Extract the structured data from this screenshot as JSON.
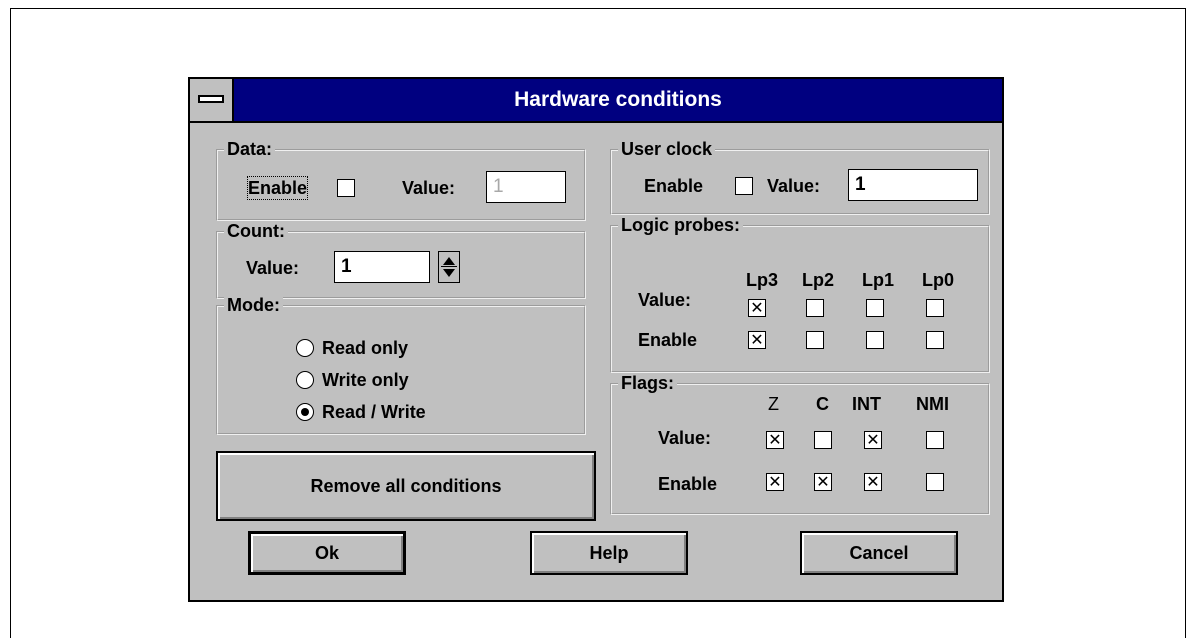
{
  "dialog": {
    "title": "Hardware conditions",
    "data_group": {
      "label": "Data:",
      "enable_label": "Enable",
      "enable_checked": false,
      "value_label": "Value:",
      "value": "1"
    },
    "count_group": {
      "label": "Count:",
      "value_label": "Value:",
      "value": "1"
    },
    "mode_group": {
      "label": "Mode:",
      "options": [
        "Read only",
        "Write only",
        "Read / Write"
      ],
      "selected": "Read / Write"
    },
    "remove_button": "Remove all conditions",
    "user_clock": {
      "label": "User clock",
      "enable_label": "Enable",
      "enable_checked": false,
      "value_label": "Value:",
      "value": "1"
    },
    "logic_probes": {
      "label": "Logic probes:",
      "columns": [
        "Lp3",
        "Lp2",
        "Lp1",
        "Lp0"
      ],
      "value_label": "Value:",
      "enable_label": "Enable",
      "value": [
        true,
        false,
        false,
        false
      ],
      "enable": [
        true,
        false,
        false,
        false
      ]
    },
    "flags": {
      "label": "Flags:",
      "columns": [
        "Z",
        "C",
        "INT",
        "NMI"
      ],
      "value_label": "Value:",
      "enable_label": "Enable",
      "value": [
        true,
        false,
        true,
        false
      ],
      "enable": [
        true,
        true,
        true,
        false
      ]
    },
    "buttons": {
      "ok": "Ok",
      "help": "Help",
      "cancel": "Cancel"
    }
  }
}
